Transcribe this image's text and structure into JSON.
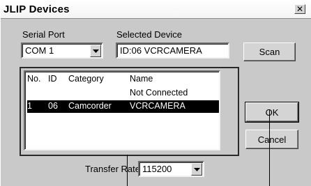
{
  "window": {
    "title": "JLIP Devices",
    "close_glyph": "✕"
  },
  "serial_port": {
    "label": "Serial Port",
    "value": "COM 1"
  },
  "selected_device": {
    "label": "Selected Device",
    "value": "ID:06 VCRCAMERA"
  },
  "buttons": {
    "scan": "Scan",
    "ok": "OK",
    "cancel": "Cancel"
  },
  "device_list": {
    "columns": [
      "No.",
      "ID",
      "Category",
      "Name"
    ],
    "rows": [
      {
        "no": "",
        "id": "",
        "category": "",
        "name": "Not Connected",
        "selected": false
      },
      {
        "no": "1",
        "id": "06",
        "category": "Camcorder",
        "name": "VCRCAMERA",
        "selected": true
      }
    ]
  },
  "transfer_rate": {
    "label": "Transfer Rate",
    "value": "115200"
  },
  "icons": {
    "dropdown": "chevron-down-icon",
    "close": "close-icon"
  }
}
